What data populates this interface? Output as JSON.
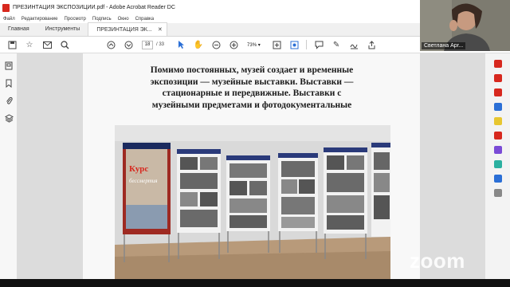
{
  "window": {
    "title": "ПРЕЗИНТАЦИЯ ЭКСПОЗИЦИИ.pdf - Adobe Acrobat Reader DC"
  },
  "menu": [
    "Файл",
    "Редактирование",
    "Просмотр",
    "Подпись",
    "Окно",
    "Справка"
  ],
  "tabs": {
    "home": "Главная",
    "tools": "Инструменты",
    "document": "ПРЕЗИНТАЦИЯ ЭК..."
  },
  "toolbar": {
    "current_page": "18",
    "total_pages": "/ 33",
    "zoom": "73%"
  },
  "slide": {
    "text": "Помимо постоянных, музей создает и временные экспозиции —   музейные выставки. Выставки — стационарные и передвижные. Выставки с музейными предметами и фотодокументальные"
  },
  "poster": {
    "line1": "Курс",
    "line2": "бессмертия"
  },
  "video": {
    "participant_name": "Светлана Арг..."
  },
  "watermark": "zoom",
  "colors": {
    "accent_red": "#d7281e",
    "accent_blue": "#2b6fd6"
  }
}
